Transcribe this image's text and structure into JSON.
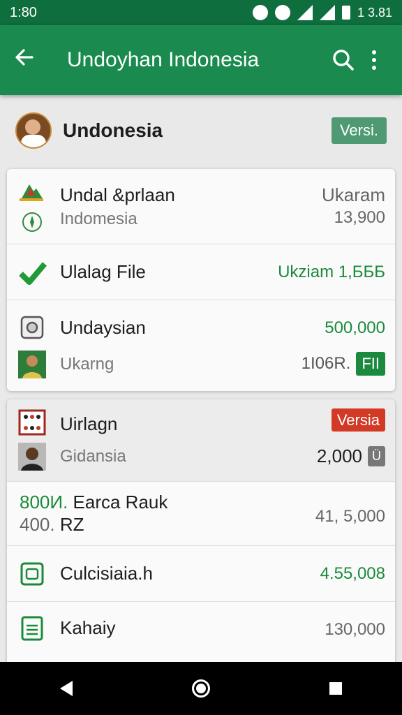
{
  "status_bar": {
    "time": "1:80",
    "right_text": "1 3.81",
    "icons": [
      "check-icon",
      "face-icon",
      "wifi-icon",
      "signal-icon",
      "battery-icon"
    ]
  },
  "app_bar": {
    "title": "Undoyhan Indonesia",
    "back_icon": "arrow-left-icon",
    "search_icon": "search-icon",
    "more_icon": "more-vertical-icon",
    "color": "#1a8a4e"
  },
  "profile": {
    "name": "Undonesia",
    "chip": "Versi."
  },
  "card1": {
    "row1": {
      "title": "Undal &prlaan",
      "subtitle": "Indomesia",
      "value_top": "Ukaram",
      "value_bottom": "13,900"
    },
    "row2": {
      "title": "Ulalag File",
      "value": "Ukziam 1,БББ"
    },
    "row3": {
      "title": "Undaysian",
      "subtitle": "Ukarng",
      "value_top": "500,000",
      "value_bottom": "1I06R.",
      "badge": "FII"
    }
  },
  "card2": {
    "row1": {
      "title": "Uirlagn",
      "subtitle": "Gidansia",
      "badge": "Versia",
      "value": "2,000",
      "small_badge": "Ü"
    },
    "row2": {
      "line1_green": "800И.",
      "line1_text": "Earca Rauk",
      "line2_grey": "400.",
      "line2_text": "RZ",
      "value": "41, 5,000"
    },
    "row3": {
      "title": "Culcisiaia.h",
      "value": "4.55,008"
    },
    "row4": {
      "title": "Kahaiy",
      "value": "130,000"
    }
  },
  "nav_bar": {
    "back_icon": "nav-back-icon",
    "home_icon": "nav-home-icon",
    "recent_icon": "nav-recent-icon"
  }
}
